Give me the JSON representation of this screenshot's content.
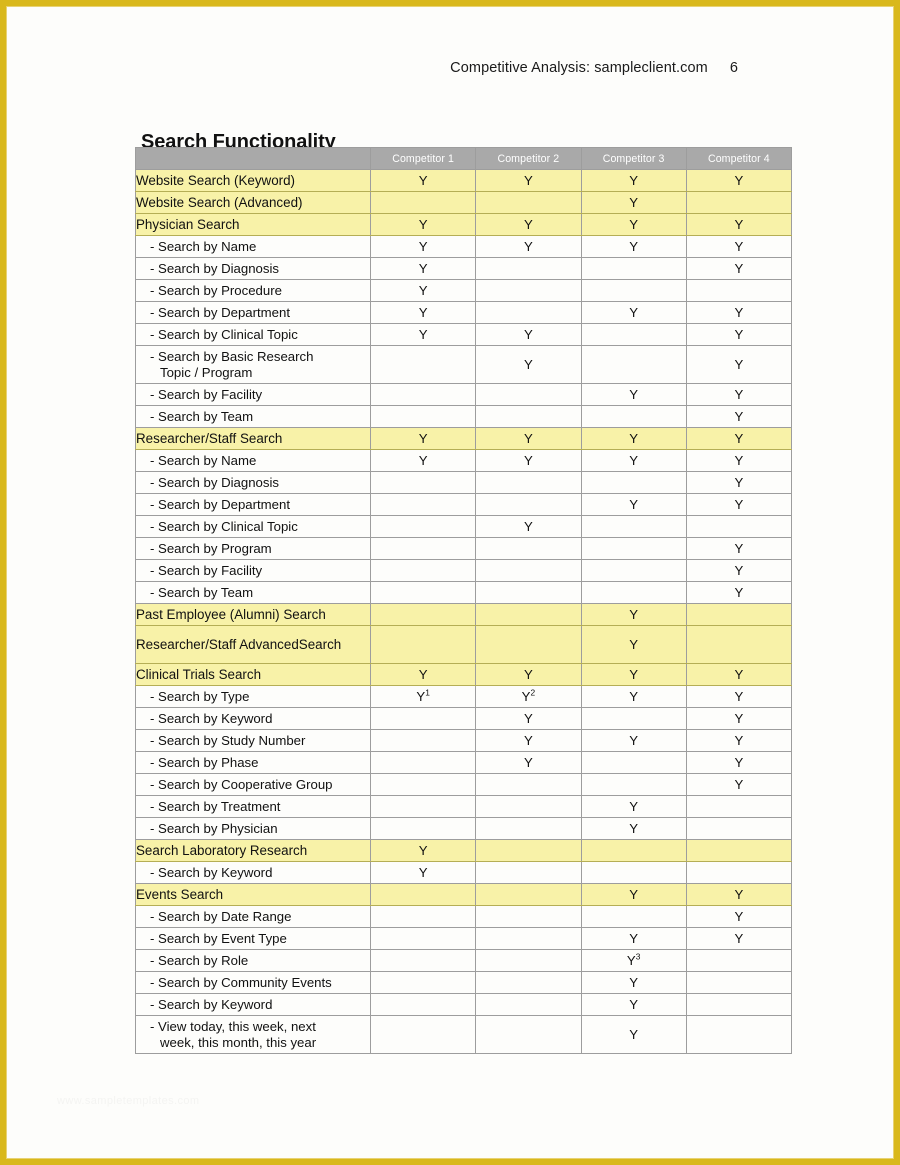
{
  "header": {
    "running_title": "Competitive Analysis: sampleclient.com",
    "page_number": "6"
  },
  "section": {
    "title": "Search Functionality"
  },
  "watermark": {
    "text": "www.sampletemplates.com"
  },
  "table": {
    "columns": [
      {
        "key": "feature",
        "label": ""
      },
      {
        "key": "c1",
        "label": "Competitor 1"
      },
      {
        "key": "c2",
        "label": "Competitor 2"
      },
      {
        "key": "c3",
        "label": "Competitor 3"
      },
      {
        "key": "c4",
        "label": "Competitor 4"
      }
    ],
    "yes_mark": "Y",
    "footnote_marks": [
      "1",
      "2",
      "3"
    ],
    "rows": [
      {
        "feature": "Website Search (Keyword)",
        "kind": "category",
        "lines": 1,
        "c1": "Y",
        "c2": "Y",
        "c3": "Y",
        "c4": "Y"
      },
      {
        "feature": "Website Search (Advanced)",
        "kind": "category",
        "lines": 1,
        "c1": "",
        "c2": "",
        "c3": "Y",
        "c4": ""
      },
      {
        "feature": "Physician Search",
        "kind": "category",
        "lines": 1,
        "c1": "Y",
        "c2": "Y",
        "c3": "Y",
        "c4": "Y"
      },
      {
        "feature": "- Search by Name",
        "kind": "sub",
        "lines": 1,
        "c1": "Y",
        "c2": "Y",
        "c3": "Y",
        "c4": "Y"
      },
      {
        "feature": "- Search by Diagnosis",
        "kind": "sub",
        "lines": 1,
        "c1": "Y",
        "c2": "",
        "c3": "",
        "c4": "Y"
      },
      {
        "feature": "- Search by Procedure",
        "kind": "sub",
        "lines": 1,
        "c1": "Y",
        "c2": "",
        "c3": "",
        "c4": ""
      },
      {
        "feature": "- Search by Department",
        "kind": "sub",
        "lines": 1,
        "c1": "Y",
        "c2": "",
        "c3": "Y",
        "c4": "Y"
      },
      {
        "feature": "- Search by Clinical Topic",
        "kind": "sub",
        "lines": 1,
        "c1": "Y",
        "c2": "Y",
        "c3": "",
        "c4": "Y"
      },
      {
        "feature": "- Search by Basic Research Topic / Program",
        "feature_line1": "- Search by Basic Research",
        "feature_line2": "Topic / Program",
        "kind": "sub",
        "lines": 2,
        "c1": "",
        "c2": "Y",
        "c3": "",
        "c4": "Y"
      },
      {
        "feature": "- Search by Facility",
        "kind": "sub",
        "lines": 1,
        "c1": "",
        "c2": "",
        "c3": "Y",
        "c4": "Y"
      },
      {
        "feature": "- Search by Team",
        "kind": "sub",
        "lines": 1,
        "c1": "",
        "c2": "",
        "c3": "",
        "c4": "Y"
      },
      {
        "feature": "Researcher/Staff Search",
        "kind": "category",
        "lines": 1,
        "c1": "Y",
        "c2": "Y",
        "c3": "Y",
        "c4": "Y"
      },
      {
        "feature": "- Search by Name",
        "kind": "sub",
        "lines": 1,
        "c1": "Y",
        "c2": "Y",
        "c3": "Y",
        "c4": "Y"
      },
      {
        "feature": "- Search by Diagnosis",
        "kind": "sub",
        "lines": 1,
        "c1": "",
        "c2": "",
        "c3": "",
        "c4": "Y"
      },
      {
        "feature": "- Search by Department",
        "kind": "sub",
        "lines": 1,
        "c1": "",
        "c2": "",
        "c3": "Y",
        "c4": "Y"
      },
      {
        "feature": "- Search by Clinical Topic",
        "kind": "sub",
        "lines": 1,
        "c1": "",
        "c2": "Y",
        "c3": "",
        "c4": ""
      },
      {
        "feature": "- Search by Program",
        "kind": "sub",
        "lines": 1,
        "c1": "",
        "c2": "",
        "c3": "",
        "c4": "Y"
      },
      {
        "feature": "- Search by Facility",
        "kind": "sub",
        "lines": 1,
        "c1": "",
        "c2": "",
        "c3": "",
        "c4": "Y"
      },
      {
        "feature": "- Search by Team",
        "kind": "sub",
        "lines": 1,
        "c1": "",
        "c2": "",
        "c3": "",
        "c4": "Y"
      },
      {
        "feature": "Past Employee (Alumni) Search",
        "kind": "category",
        "lines": 1,
        "c1": "",
        "c2": "",
        "c3": "Y",
        "c4": ""
      },
      {
        "feature": "Researcher/Staff Advanced Search",
        "feature_line1": "Researcher/Staff Advanced",
        "feature_line2": "Search",
        "kind": "category",
        "lines": 2,
        "c1": "",
        "c2": "",
        "c3": "Y",
        "c4": ""
      },
      {
        "feature": "Clinical Trials Search",
        "kind": "category",
        "lines": 1,
        "c1": "Y",
        "c2": "Y",
        "c3": "Y",
        "c4": "Y"
      },
      {
        "feature": "- Search by Type",
        "kind": "sub",
        "lines": 1,
        "c1": "Y",
        "c1_sup": "1",
        "c2": "Y",
        "c2_sup": "2",
        "c3": "Y",
        "c4": "Y"
      },
      {
        "feature": "- Search by Keyword",
        "kind": "sub",
        "lines": 1,
        "c1": "",
        "c2": "Y",
        "c3": "",
        "c4": "Y"
      },
      {
        "feature": "- Search by Study Number",
        "kind": "sub",
        "lines": 1,
        "c1": "",
        "c2": "Y",
        "c3": "Y",
        "c4": "Y"
      },
      {
        "feature": "- Search by Phase",
        "kind": "sub",
        "lines": 1,
        "c1": "",
        "c2": "Y",
        "c3": "",
        "c4": "Y"
      },
      {
        "feature": "- Search by Cooperative Group",
        "kind": "sub",
        "lines": 1,
        "c1": "",
        "c2": "",
        "c3": "",
        "c4": "Y"
      },
      {
        "feature": "- Search by Treatment",
        "kind": "sub",
        "lines": 1,
        "c1": "",
        "c2": "",
        "c3": "Y",
        "c4": ""
      },
      {
        "feature": "- Search by Physician",
        "kind": "sub",
        "lines": 1,
        "c1": "",
        "c2": "",
        "c3": "Y",
        "c4": ""
      },
      {
        "feature": "Search Laboratory Research",
        "kind": "category",
        "lines": 1,
        "c1": "Y",
        "c2": "",
        "c3": "",
        "c4": ""
      },
      {
        "feature": "- Search by Keyword",
        "kind": "sub",
        "lines": 1,
        "c1": "Y",
        "c2": "",
        "c3": "",
        "c4": ""
      },
      {
        "feature": "Events Search",
        "kind": "category",
        "lines": 1,
        "c1": "",
        "c2": "",
        "c3": "Y",
        "c4": "Y"
      },
      {
        "feature": "- Search by Date Range",
        "kind": "sub",
        "lines": 1,
        "c1": "",
        "c2": "",
        "c3": "",
        "c4": "Y"
      },
      {
        "feature": "- Search by Event Type",
        "kind": "sub",
        "lines": 1,
        "c1": "",
        "c2": "",
        "c3": "Y",
        "c4": "Y"
      },
      {
        "feature": "- Search by Role",
        "kind": "sub",
        "lines": 1,
        "c1": "",
        "c2": "",
        "c3": "Y",
        "c3_sup": "3",
        "c4": ""
      },
      {
        "feature": "- Search by Community Events",
        "kind": "sub",
        "lines": 1,
        "c1": "",
        "c2": "",
        "c3": "Y",
        "c4": ""
      },
      {
        "feature": "- Search by Keyword",
        "kind": "sub",
        "lines": 1,
        "c1": "",
        "c2": "",
        "c3": "Y",
        "c4": ""
      },
      {
        "feature": "- View today, this week, next week, this month, this year",
        "feature_line1": "- View today, this week, next",
        "feature_line2": "week, this month, this year",
        "kind": "sub",
        "lines": 2,
        "c1": "",
        "c2": "",
        "c3": "Y",
        "c4": ""
      }
    ]
  },
  "colors": {
    "page_border": "#d9b81c",
    "header_bg": "#a9a9a9",
    "header_text": "#ffffff",
    "highlight_row": "#f8f2a8",
    "grid_line": "#9d9d9d",
    "text": "#111111"
  }
}
